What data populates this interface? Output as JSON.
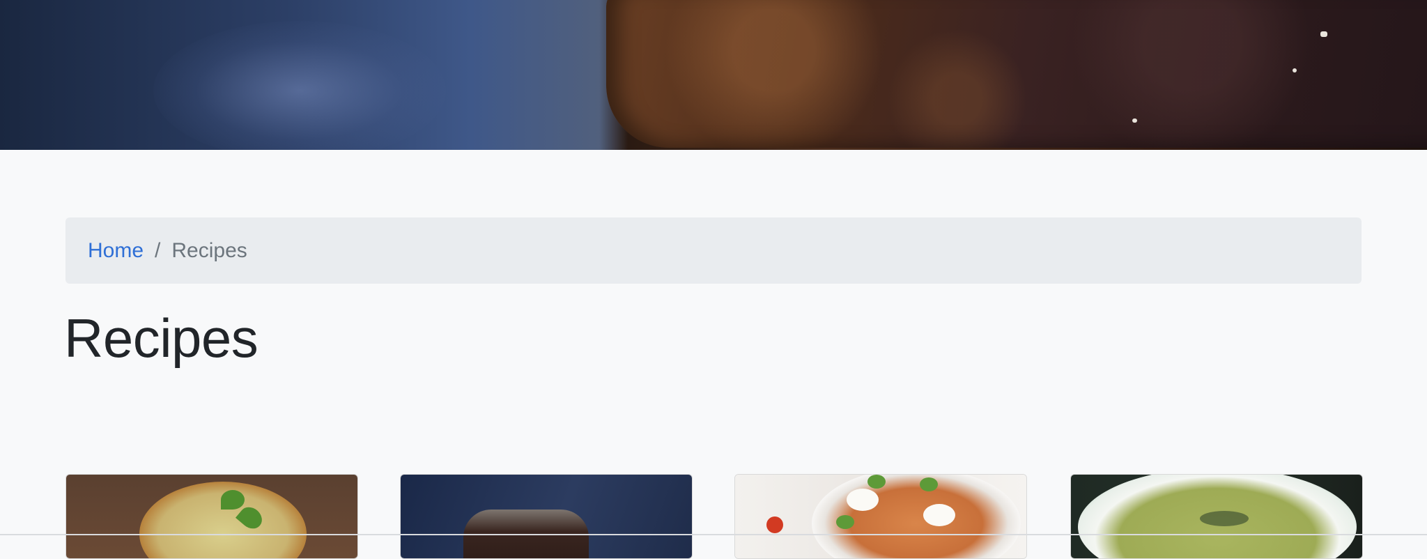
{
  "hero": {
    "image_description_icon": "brownie-photo-icon"
  },
  "breadcrumb": {
    "home_label": "Home",
    "separator": "/",
    "current_label": "Recipes"
  },
  "page": {
    "title": "Recipes"
  },
  "cards": [
    {
      "image_icon": "quiche-photo-icon"
    },
    {
      "image_icon": "chocolate-tart-photo-icon"
    },
    {
      "image_icon": "pasta-photo-icon"
    },
    {
      "image_icon": "green-soup-photo-icon"
    }
  ],
  "colors": {
    "background": "#f8f9fa",
    "breadcrumb_bg": "#e9ecef",
    "link": "#2f6fd6",
    "muted": "#6c757d",
    "heading": "#212529"
  }
}
